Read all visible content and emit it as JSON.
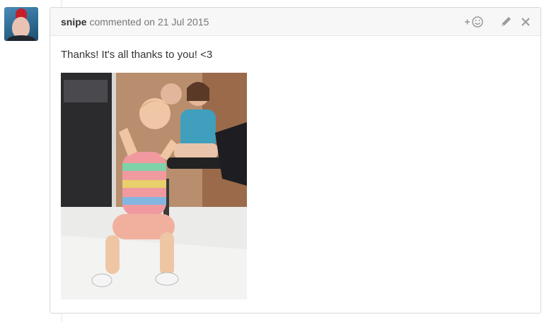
{
  "comment": {
    "author": "snipe",
    "action_text": "commented on",
    "date": "21 Jul 2015",
    "body": "Thanks! It's all thanks to you! <3",
    "avatar_icon": "user-avatar",
    "image_icon": "animated-gif"
  },
  "actions": {
    "reaction_icon": "add-reaction-icon",
    "edit_icon": "pencil-icon",
    "delete_icon": "close-icon"
  }
}
